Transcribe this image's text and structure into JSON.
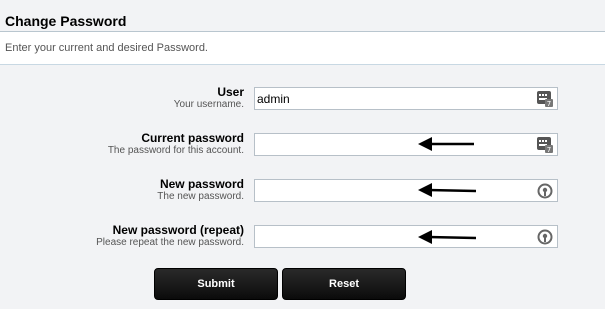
{
  "header": {
    "title": "Change Password",
    "subtitle": "Enter your current and desired Password."
  },
  "form": {
    "user": {
      "label": "User",
      "hint": "Your username.",
      "value": "admin",
      "icon": "keyboard-icon"
    },
    "current_password": {
      "label": "Current password",
      "hint": "The password for this account.",
      "value": "",
      "icon": "keyboard-icon"
    },
    "new_password": {
      "label": "New password",
      "hint": "The new password.",
      "value": "",
      "icon": "lock-icon"
    },
    "new_password_repeat": {
      "label": "New password (repeat)",
      "hint": "Please repeat the new password.",
      "value": "",
      "icon": "lock-icon"
    }
  },
  "buttons": {
    "submit": "Submit",
    "reset": "Reset"
  }
}
